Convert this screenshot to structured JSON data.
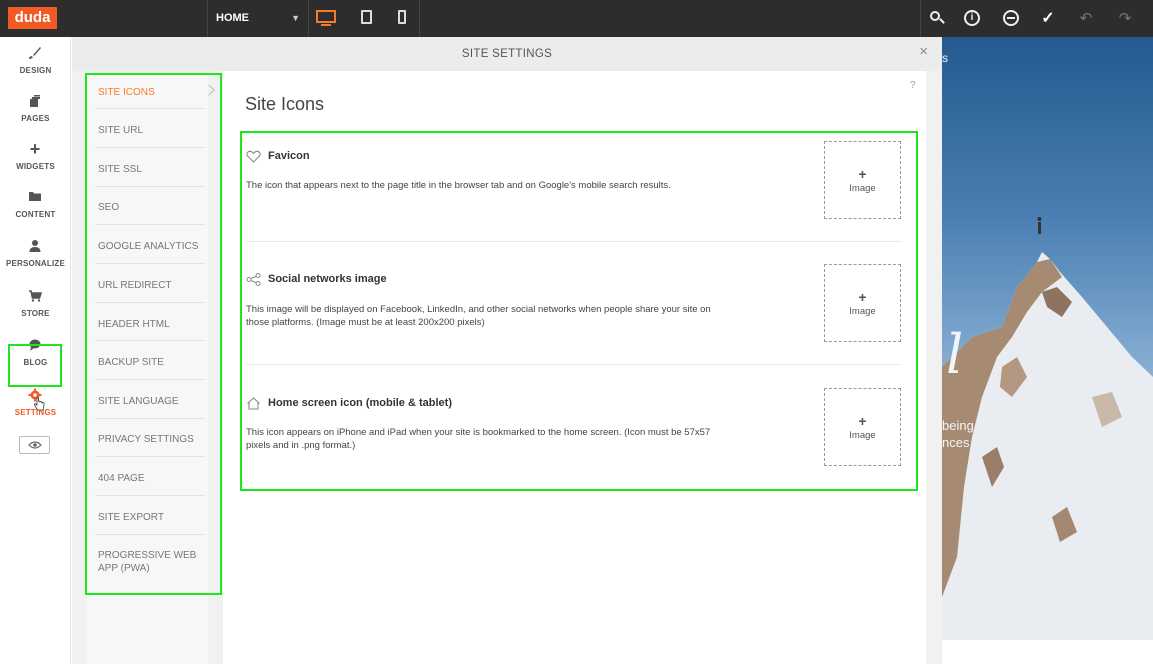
{
  "topbar": {
    "logo": "duda",
    "page_select": "HOME",
    "page_select_icon": "chevron-down-icon"
  },
  "leftnav": {
    "items": [
      {
        "label": "DESIGN",
        "icon": "brush-icon"
      },
      {
        "label": "PAGES",
        "icon": "pages-icon"
      },
      {
        "label": "WIDGETS",
        "icon": "plus-icon"
      },
      {
        "label": "CONTENT",
        "icon": "folder-icon"
      },
      {
        "label": "PERSONALIZE",
        "icon": "user-icon"
      },
      {
        "label": "STORE",
        "icon": "cart-icon"
      },
      {
        "label": "BLOG",
        "icon": "speech-bubble-icon"
      },
      {
        "label": "SETTINGS",
        "icon": "gear-icon"
      }
    ]
  },
  "modal": {
    "title": "SITE SETTINGS",
    "close": "×",
    "help": "?",
    "content_title": "Site Icons"
  },
  "subnav": {
    "items": [
      {
        "label": "SITE ICONS"
      },
      {
        "label": "SITE URL"
      },
      {
        "label": "SITE SSL"
      },
      {
        "label": "SEO"
      },
      {
        "label": "GOOGLE ANALYTICS"
      },
      {
        "label": "URL REDIRECT"
      },
      {
        "label": "HEADER HTML"
      },
      {
        "label": "BACKUP SITE"
      },
      {
        "label": "SITE LANGUAGE"
      },
      {
        "label": "PRIVACY SETTINGS"
      },
      {
        "label": "404 PAGE"
      },
      {
        "label": "SITE EXPORT"
      },
      {
        "label": "PROGRESSIVE WEB APP (PWA)"
      }
    ]
  },
  "cards": [
    {
      "icon": "heart-icon",
      "title": "Favicon",
      "desc": "The icon that appears next to the page title in the browser tab and on Google's mobile search results.",
      "button_plus": "+",
      "button_label": "Image"
    },
    {
      "icon": "share-icon",
      "title": "Social networks image",
      "desc": "This image will be displayed on Facebook, LinkedIn, and other social networks when people share your site on those platforms. (Image must be at least 200x200 pixels)",
      "button_plus": "+",
      "button_label": "Image"
    },
    {
      "icon": "home-icon",
      "title": "Home screen icon (mobile & tablet)",
      "desc": "This icon appears on iPhone and iPad when your site is bookmarked to the home screen. (Icon must be 57x57 pixels and in .png format.)",
      "button_plus": "+",
      "button_label": "Image"
    }
  ],
  "preview": {
    "text_top": "s",
    "text_big": "l",
    "text_line1": "being",
    "text_line2": "nces,"
  }
}
